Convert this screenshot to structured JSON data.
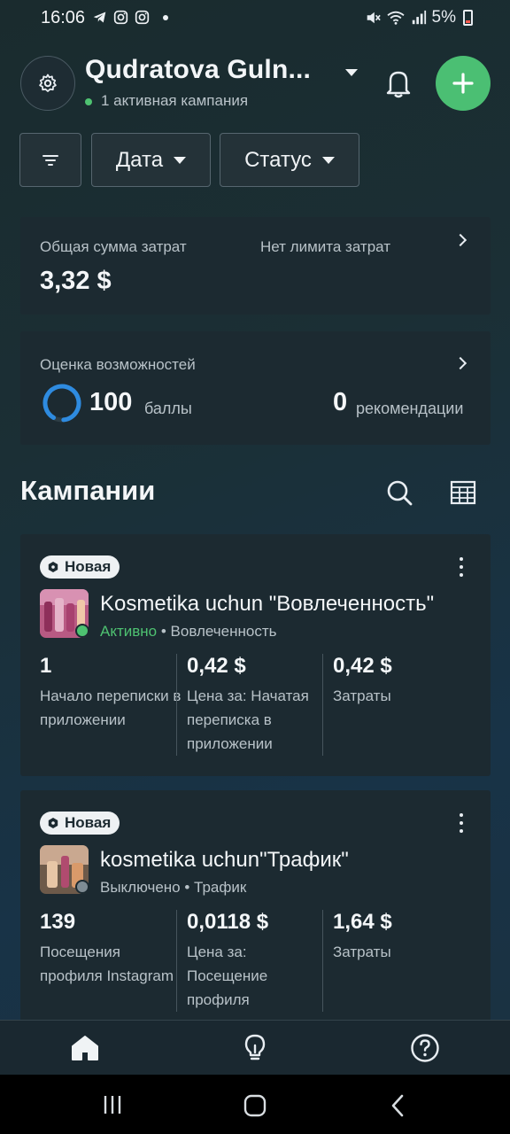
{
  "status_bar": {
    "time": "16:06",
    "battery": "5%",
    "icons_left": [
      "telegram-icon",
      "instagram-icon",
      "instagram-icon"
    ],
    "icons_right": [
      "mute-icon",
      "wifi-icon",
      "signal-icon",
      "battery-icon"
    ]
  },
  "header": {
    "account_name": "Qudratova Guln...",
    "active_campaigns": "1 активная кампания",
    "colors": {
      "accent_green": "#4bbf73",
      "active_dot": "#4ec271"
    }
  },
  "filters": {
    "date_label": "Дата",
    "status_label": "Статус"
  },
  "spend": {
    "label": "Общая сумма затрат",
    "value": "3,32 $",
    "limit_label": "Нет лимита затрат"
  },
  "opportunity": {
    "label": "Оценка возможностей",
    "score": "100",
    "score_unit": "баллы",
    "score_fraction": 0.9,
    "recommendations_count": "0",
    "recommendations_label": "рекомендации"
  },
  "campaigns": {
    "title": "Кампании",
    "items": [
      {
        "badge": "Новая",
        "name": "Kosmetika uchun \"Вовлеченность\"",
        "status": "Активно",
        "status_color": "#4ec271",
        "objective": "• Вовлеченность",
        "metrics": [
          {
            "value": "1",
            "label": "Начало переписки в приложении"
          },
          {
            "value": "0,42 $",
            "label": "Цена за: Начатая переписка в приложении"
          },
          {
            "value": "0,42 $",
            "label": "Затраты"
          }
        ]
      },
      {
        "badge": "Новая",
        "name": "kosmetika uchun\"Трафик\"",
        "status": "Выключено",
        "status_color": "#7f8c94",
        "objective": "• Трафик",
        "metrics": [
          {
            "value": "139",
            "label": "Посещения профиля Instagram"
          },
          {
            "value": "0,0118 $",
            "label": "Цена за: Посещение профиля"
          },
          {
            "value": "1,64 $",
            "label": "Затраты"
          }
        ]
      }
    ]
  },
  "bottom_nav": [
    "home-icon",
    "lightbulb-icon",
    "help-icon"
  ]
}
